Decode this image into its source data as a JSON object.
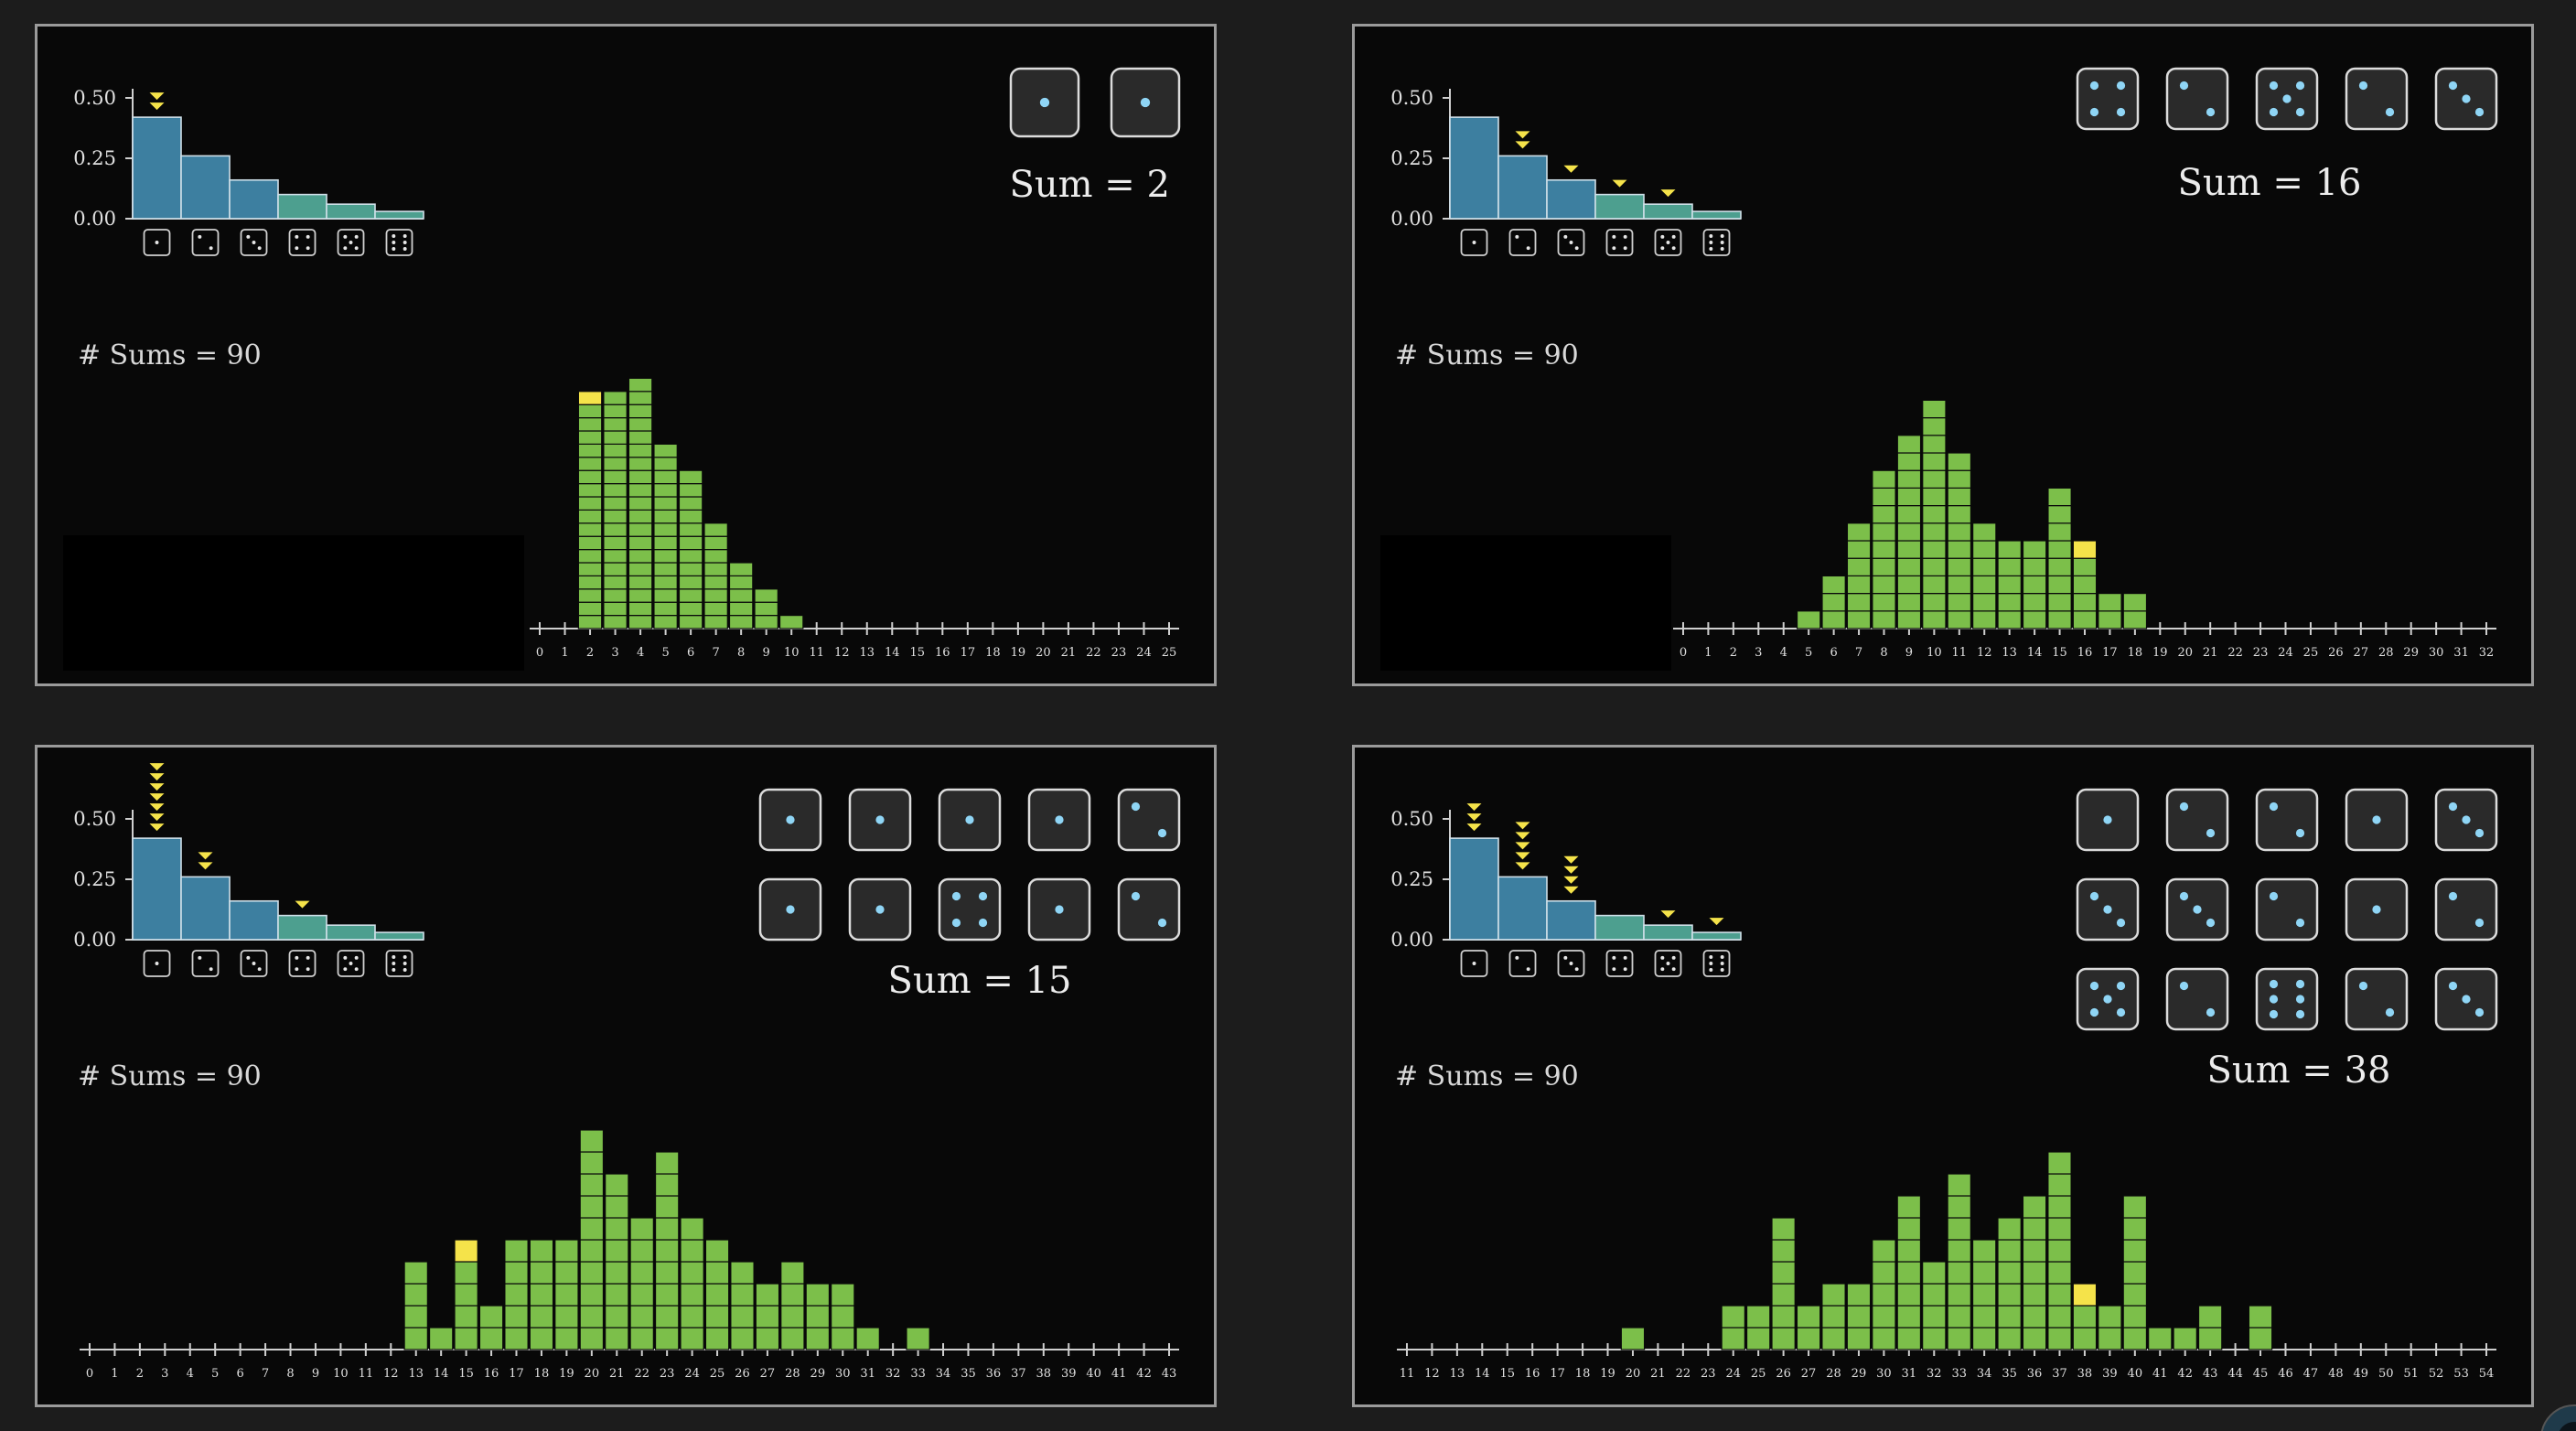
{
  "colors": {
    "background": "#1c1c1c",
    "panel": "#080808",
    "panel_border": "#9a9a9a",
    "dist_bar": "#3d7fa0",
    "dist_bar_tail": "#4d9f8f",
    "sum_bar": "#7cbf4a",
    "highlight": "#f5e34a",
    "die_face": "#2a2a2a",
    "die_pip": "#8fd5f5",
    "axis": "#cfcfcf"
  },
  "chart_data": [
    {
      "type": "bar",
      "panel_id": "top-left",
      "distribution": {
        "categories": [
          "1",
          "2",
          "3",
          "4",
          "5",
          "6"
        ],
        "category_icons": [
          "die-face-1",
          "die-face-2",
          "die-face-3",
          "die-face-4",
          "die-face-5",
          "die-face-6"
        ],
        "values": [
          0.42,
          0.26,
          0.16,
          0.1,
          0.06,
          0.03
        ],
        "y_ticks": [
          "0.50",
          "0.25",
          "0.00"
        ],
        "ylim": [
          0,
          0.5
        ],
        "marker_counts": [
          2,
          0,
          0,
          0,
          0,
          0
        ]
      },
      "dice": [
        [
          1,
          1
        ]
      ],
      "sum_text": "Sum = 2",
      "count_text": "# Sums = 90",
      "histogram": {
        "x_min": 0,
        "x_max": 25,
        "x_ticks": [
          "0",
          "1",
          "2",
          "3",
          "4",
          "5",
          "6",
          "7",
          "8",
          "9",
          "10",
          "11",
          "12",
          "13",
          "14",
          "15",
          "16",
          "17",
          "18",
          "19",
          "20",
          "21",
          "22",
          "23",
          "24",
          "25"
        ],
        "categories": [
          2,
          3,
          4,
          5,
          6,
          7,
          8,
          9,
          10
        ],
        "counts": [
          18,
          18,
          19,
          14,
          12,
          8,
          5,
          3,
          1
        ],
        "highlight_sum": 2
      }
    },
    {
      "type": "bar",
      "panel_id": "top-right",
      "distribution": {
        "categories": [
          "1",
          "2",
          "3",
          "4",
          "5",
          "6"
        ],
        "category_icons": [
          "die-face-1",
          "die-face-2",
          "die-face-3",
          "die-face-4",
          "die-face-5",
          "die-face-6"
        ],
        "values": [
          0.42,
          0.26,
          0.16,
          0.1,
          0.06,
          0.03
        ],
        "y_ticks": [
          "0.50",
          "0.25",
          "0.00"
        ],
        "ylim": [
          0,
          0.5
        ],
        "marker_counts": [
          0,
          2,
          1,
          1,
          1,
          0
        ]
      },
      "dice": [
        [
          4,
          2,
          5,
          2,
          3
        ]
      ],
      "sum_text": "Sum = 16",
      "count_text": "# Sums = 90",
      "histogram": {
        "x_min": 0,
        "x_max": 32,
        "x_ticks": [
          "0",
          "1",
          "2",
          "3",
          "4",
          "5",
          "6",
          "7",
          "8",
          "9",
          "10",
          "11",
          "12",
          "13",
          "14",
          "15",
          "16",
          "17",
          "18",
          "19",
          "20",
          "21",
          "22",
          "23",
          "24",
          "25",
          "26",
          "27",
          "28",
          "29",
          "30",
          "31",
          "32"
        ],
        "categories": [
          5,
          6,
          7,
          8,
          9,
          10,
          11,
          12,
          13,
          14,
          15,
          16,
          17,
          18
        ],
        "counts": [
          1,
          3,
          6,
          9,
          11,
          13,
          10,
          6,
          5,
          5,
          8,
          5,
          2,
          2
        ],
        "highlight_sum": 16
      }
    },
    {
      "type": "bar",
      "panel_id": "bottom-left",
      "distribution": {
        "categories": [
          "1",
          "2",
          "3",
          "4",
          "5",
          "6"
        ],
        "category_icons": [
          "die-face-1",
          "die-face-2",
          "die-face-3",
          "die-face-4",
          "die-face-5",
          "die-face-6"
        ],
        "values": [
          0.42,
          0.26,
          0.16,
          0.1,
          0.06,
          0.03
        ],
        "y_ticks": [
          "0.50",
          "0.25",
          "0.00"
        ],
        "ylim": [
          0,
          0.5
        ],
        "marker_counts": [
          7,
          2,
          0,
          1,
          0,
          0
        ]
      },
      "dice": [
        [
          1,
          1,
          1,
          1,
          2
        ],
        [
          1,
          1,
          4,
          1,
          2
        ]
      ],
      "sum_text": "Sum = 15",
      "count_text": "# Sums = 90",
      "histogram": {
        "x_min": 0,
        "x_max": 43,
        "x_ticks": [
          "0",
          "1",
          "2",
          "3",
          "4",
          "5",
          "6",
          "7",
          "8",
          "9",
          "10",
          "11",
          "12",
          "13",
          "14",
          "15",
          "16",
          "17",
          "18",
          "19",
          "20",
          "21",
          "22",
          "23",
          "24",
          "25",
          "26",
          "27",
          "28",
          "29",
          "30",
          "31",
          "32",
          "33",
          "34",
          "35",
          "36",
          "37",
          "38",
          "39",
          "40",
          "41",
          "42",
          "43"
        ],
        "categories": [
          13,
          14,
          15,
          16,
          17,
          18,
          19,
          20,
          21,
          22,
          23,
          24,
          25,
          26,
          27,
          28,
          29,
          30,
          31,
          32,
          33
        ],
        "counts": [
          4,
          1,
          5,
          2,
          5,
          5,
          5,
          10,
          8,
          6,
          9,
          6,
          5,
          4,
          3,
          4,
          3,
          3,
          1,
          0,
          1
        ],
        "highlight_sum": 15
      }
    },
    {
      "type": "bar",
      "panel_id": "bottom-right",
      "distribution": {
        "categories": [
          "1",
          "2",
          "3",
          "4",
          "5",
          "6"
        ],
        "category_icons": [
          "die-face-1",
          "die-face-2",
          "die-face-3",
          "die-face-4",
          "die-face-5",
          "die-face-6"
        ],
        "values": [
          0.42,
          0.26,
          0.16,
          0.1,
          0.06,
          0.03
        ],
        "y_ticks": [
          "0.50",
          "0.25",
          "0.00"
        ],
        "ylim": [
          0,
          0.5
        ],
        "marker_counts": [
          3,
          5,
          4,
          0,
          1,
          1
        ]
      },
      "dice": [
        [
          1,
          2,
          2,
          1,
          3
        ],
        [
          3,
          3,
          2,
          1,
          2
        ],
        [
          5,
          2,
          6,
          2,
          3
        ]
      ],
      "sum_text": "Sum = 38",
      "count_text": "# Sums = 90",
      "histogram": {
        "x_min": 11,
        "x_max": 54,
        "x_ticks": [
          "11",
          "12",
          "13",
          "14",
          "15",
          "16",
          "17",
          "18",
          "19",
          "20",
          "21",
          "22",
          "23",
          "24",
          "25",
          "26",
          "27",
          "28",
          "29",
          "30",
          "31",
          "32",
          "33",
          "34",
          "35",
          "36",
          "37",
          "38",
          "39",
          "40",
          "41",
          "42",
          "43",
          "44",
          "45",
          "46",
          "47",
          "48",
          "49",
          "50",
          "51",
          "52",
          "53",
          "54"
        ],
        "categories": [
          20,
          21,
          22,
          23,
          24,
          25,
          26,
          27,
          28,
          29,
          30,
          31,
          32,
          33,
          34,
          35,
          36,
          37,
          38,
          39,
          40,
          41,
          42,
          43,
          44,
          45
        ],
        "counts": [
          1,
          0,
          0,
          0,
          2,
          2,
          6,
          2,
          3,
          3,
          5,
          7,
          4,
          8,
          5,
          6,
          7,
          9,
          3,
          2,
          7,
          1,
          1,
          2,
          0,
          2
        ],
        "highlight_sum": 38
      }
    }
  ]
}
